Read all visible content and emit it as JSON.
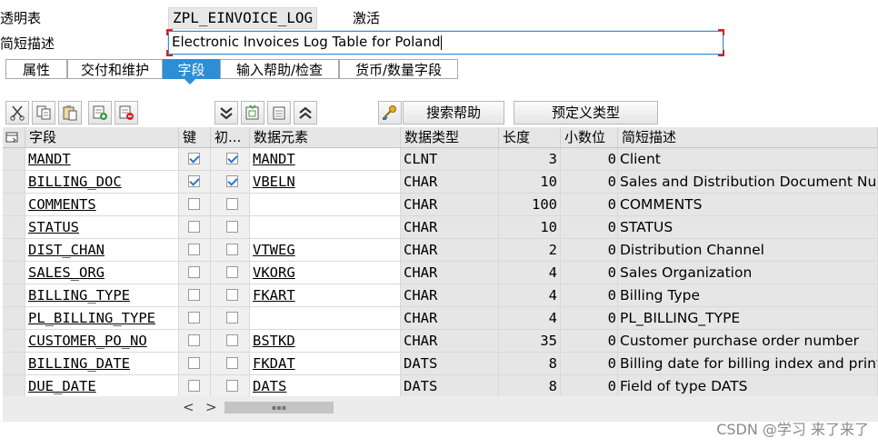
{
  "header": {
    "table_label": "透明表",
    "table_name": "ZPL_EINVOICE_LOG",
    "status": "激活",
    "desc_label": "简短描述",
    "desc_value": "Electronic Invoices Log Table for Poland"
  },
  "tabs": [
    {
      "label": "属性",
      "active": false
    },
    {
      "label": "交付和维护",
      "active": false
    },
    {
      "label": "字段",
      "active": true
    },
    {
      "label": "输入帮助/检查",
      "active": false
    },
    {
      "label": "货币/数量字段",
      "active": false
    }
  ],
  "toolbar": {
    "icons": [
      "cut-icon",
      "copy-icon",
      "paste-icon",
      "insert-row-icon",
      "delete-row-icon",
      "expand-all-icon",
      "insert-structure-icon",
      "copy-structure-icon",
      "collapse-all-icon",
      "search-help-icon"
    ],
    "search_help_label": "搜索帮助",
    "predefined_type_label": "预定义类型"
  },
  "columns": {
    "field": "字段",
    "key": "键",
    "init": "初...",
    "data_element": "数据元素",
    "data_type": "数据类型",
    "length": "长度",
    "decimals": "小数位",
    "description": "简短描述"
  },
  "rows": [
    {
      "field": "MANDT",
      "key": true,
      "init": true,
      "data_element": "MANDT",
      "data_type": "CLNT",
      "length": "3",
      "decimals": "0",
      "description": "Client"
    },
    {
      "field": "BILLING_DOC",
      "key": true,
      "init": true,
      "data_element": "VBELN",
      "data_type": "CHAR",
      "length": "10",
      "decimals": "0",
      "description": "Sales and Distribution Document Number"
    },
    {
      "field": "COMMENTS",
      "key": false,
      "init": false,
      "data_element": "",
      "data_type": "CHAR",
      "length": "100",
      "decimals": "0",
      "description": "COMMENTS"
    },
    {
      "field": "STATUS",
      "key": false,
      "init": false,
      "data_element": "",
      "data_type": "CHAR",
      "length": "10",
      "decimals": "0",
      "description": "STATUS"
    },
    {
      "field": "DIST_CHAN",
      "key": false,
      "init": false,
      "data_element": "VTWEG",
      "data_type": "CHAR",
      "length": "2",
      "decimals": "0",
      "description": "Distribution Channel"
    },
    {
      "field": "SALES_ORG",
      "key": false,
      "init": false,
      "data_element": "VKORG",
      "data_type": "CHAR",
      "length": "4",
      "decimals": "0",
      "description": "Sales Organization"
    },
    {
      "field": "BILLING_TYPE",
      "key": false,
      "init": false,
      "data_element": "FKART",
      "data_type": "CHAR",
      "length": "4",
      "decimals": "0",
      "description": "Billing Type"
    },
    {
      "field": "PL_BILLING_TYPE",
      "key": false,
      "init": false,
      "data_element": "",
      "data_type": "CHAR",
      "length": "4",
      "decimals": "0",
      "description": "PL_BILLING_TYPE"
    },
    {
      "field": "CUSTOMER_PO_NO",
      "key": false,
      "init": false,
      "data_element": "BSTKD",
      "data_type": "CHAR",
      "length": "35",
      "decimals": "0",
      "description": "Customer purchase order number"
    },
    {
      "field": "BILLING_DATE",
      "key": false,
      "init": false,
      "data_element": "FKDAT",
      "data_type": "DATS",
      "length": "8",
      "decimals": "0",
      "description": "Billing date for billing index and printout"
    },
    {
      "field": "DUE_DATE",
      "key": false,
      "init": false,
      "data_element": "DATS",
      "data_type": "DATS",
      "length": "8",
      "decimals": "0",
      "description": "Field of type DATS"
    }
  ],
  "scroll": {
    "left_arrow": "<",
    "right_arrow": ">",
    "grip": "▪▪▪"
  },
  "watermark": "CSDN @学习 来了来了"
}
